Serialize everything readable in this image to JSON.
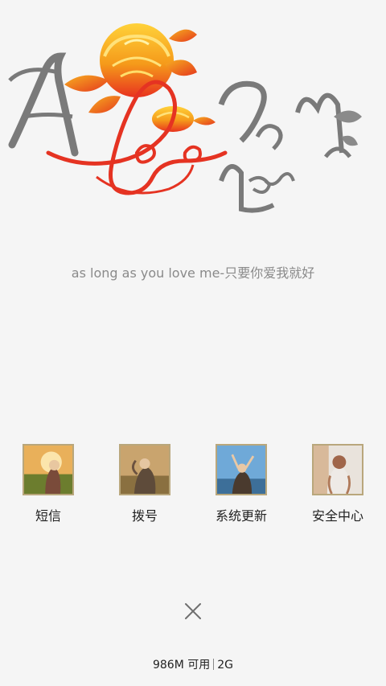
{
  "banner": {
    "logo_text": "As Long as You Love Me"
  },
  "tagline": "as long as you love me-只要你爱我就好",
  "dock": {
    "items": [
      {
        "label": "短信",
        "thumb": "girl-sunset-field-photo"
      },
      {
        "label": "拨号",
        "thumb": "girl-wind-hair-photo"
      },
      {
        "label": "系统更新",
        "thumb": "girl-arms-raised-sky-photo"
      },
      {
        "label": "安全中心",
        "thumb": "girl-backpack-photo"
      }
    ]
  },
  "close": {
    "icon": "close-icon"
  },
  "status": {
    "memory": "986M 可用",
    "total": "2G"
  },
  "colors": {
    "background": "#f5f5f5",
    "thumb_border": "#b9a77c",
    "tagline": "#8a8a8a",
    "logo_gray": "#7a7a7a",
    "logo_red": "#e53322",
    "logo_orange": "#f6a21a"
  }
}
